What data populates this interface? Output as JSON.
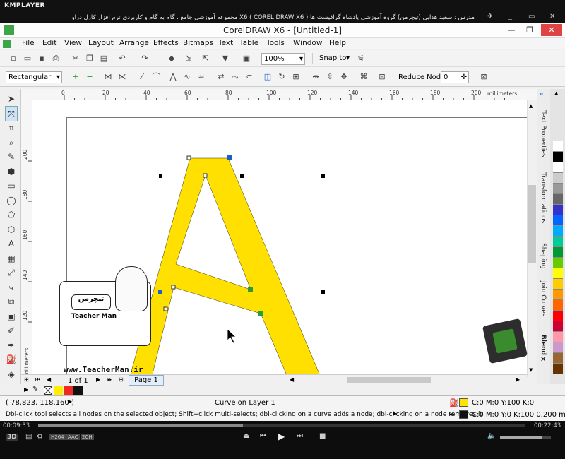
{
  "kmplayer": {
    "logo": "KMPLAYER",
    "title": "مجموعه آموزشی جامع ، گام به گام و کاربردی نرم افزار کارل دراو X6 ( COREL DRAW X6 )    مدرس : سعید هدایی (تیچرمن) گروه آموزشی پادشاه گرافیست ها",
    "pin": "✈",
    "min": "_",
    "restore": "▭",
    "close": "✕"
  },
  "window": {
    "title": "CorelDRAW X6 - [Untitled-1]",
    "min": "—",
    "restore": "❐",
    "close": "✕"
  },
  "menu": [
    "File",
    "Edit",
    "View",
    "Layout",
    "Arrange",
    "Effects",
    "Bitmaps",
    "Text",
    "Table",
    "Tools",
    "Window",
    "Help"
  ],
  "toolbar": {
    "zoom": "100%",
    "snap_to": "Snap to"
  },
  "property_bar": {
    "selection_mode": "Rectangular",
    "reduce_nodes_label": "Reduce Nodes",
    "reduce_nodes_value": "0"
  },
  "ruler": {
    "units": "millimeters",
    "top_ticks": [
      "0",
      "20",
      "40",
      "60",
      "80",
      "100",
      "120",
      "140",
      "160",
      "180",
      "200"
    ],
    "left_ticks": [
      "200",
      "180",
      "160",
      "140",
      "120"
    ],
    "left_units": "millimeters"
  },
  "dockers": [
    "Text Properties",
    "Transformations",
    "Shaping",
    "Join Curves",
    "Blend"
  ],
  "palette_colors": [
    "#ffffff",
    "#000000",
    "#ffffff",
    "#cccccc",
    "#999999",
    "#666666",
    "#3333cc",
    "#0066ff",
    "#00aaff",
    "#00cc99",
    "#009933",
    "#66cc00",
    "#ffff00",
    "#ffcc00",
    "#ff9900",
    "#ff6600",
    "#ff0000",
    "#cc0033",
    "#ff99aa",
    "#cc99cc",
    "#996633",
    "#663300"
  ],
  "doc_palette_colors": [
    "#ffee00",
    "#ee2a22",
    "#111111"
  ],
  "page_nav": {
    "current": "1 of 1",
    "page_tab": "Page 1"
  },
  "status": {
    "coords": "( 78.823, 118.160 )",
    "object_info": "Curve on Layer 1",
    "hint": "Dbl-click tool selects all nodes on the selected object; Shift+click multi-selects; dbl-clicking on a curve adds a node; dbl-clicking on a node removes it",
    "fill": "C:0 M:0 Y:100 K:0",
    "outline": "C:0 M:0 Y:0 K:100  0.200 mm",
    "fill_color": "#ffe500",
    "outline_color": "#111111"
  },
  "watermark": {
    "site": "www.TeacherMan.ir",
    "name": "Teacher Man",
    "persian": "تیچرمن"
  },
  "player": {
    "elapsed": "00:09:33",
    "total": "00:22:43",
    "progress": 0.42,
    "badges": [
      "H264",
      "AAC",
      "2CH"
    ],
    "mode": "3D"
  },
  "colors": {
    "accent_letter": "#ffe000",
    "node_blue": "#1c5fc9",
    "node_green": "#2a9c3a"
  }
}
